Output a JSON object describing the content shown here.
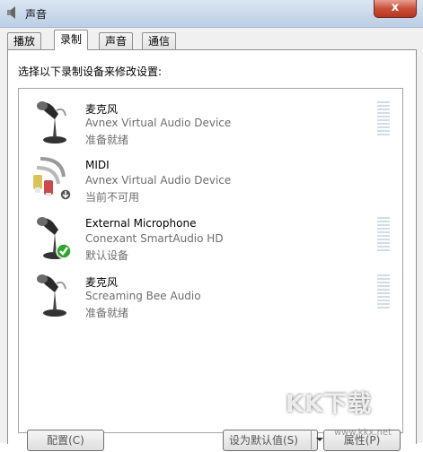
{
  "window": {
    "title": "声音",
    "close_label": "x"
  },
  "tabs": [
    {
      "label": "播放",
      "active": false
    },
    {
      "label": "录制",
      "active": true
    },
    {
      "label": "声音",
      "active": false
    },
    {
      "label": "通信",
      "active": false
    }
  ],
  "instruction": "选择以下录制设备来修改设置:",
  "devices": [
    {
      "name": "麦克风",
      "driver": "Avnex Virtual Audio Device",
      "status": "准备就绪",
      "icon": "microphone-icon"
    },
    {
      "name": "MIDI",
      "driver": "Avnex Virtual Audio Device",
      "status": "当前不可用",
      "icon": "rca-cable-icon"
    },
    {
      "name": "External Microphone",
      "driver": "Conexant SmartAudio HD",
      "status": "默认设备",
      "icon": "microphone-default-icon"
    },
    {
      "name": "麦克风",
      "driver": "Screaming Bee Audio",
      "status": "准备就绪",
      "icon": "microphone-icon"
    }
  ],
  "buttons": {
    "configure": "配置(C)",
    "set_default": "设为默认值(S)",
    "properties": "属性(P)"
  },
  "watermark": {
    "text": "KK下载",
    "url": "www.kkx.net"
  },
  "colors": {
    "title_bar": "#c9d8ea",
    "close_button": "#c9503a",
    "default_check": "#2fa52f",
    "meter_segment": "#d0dde8"
  }
}
